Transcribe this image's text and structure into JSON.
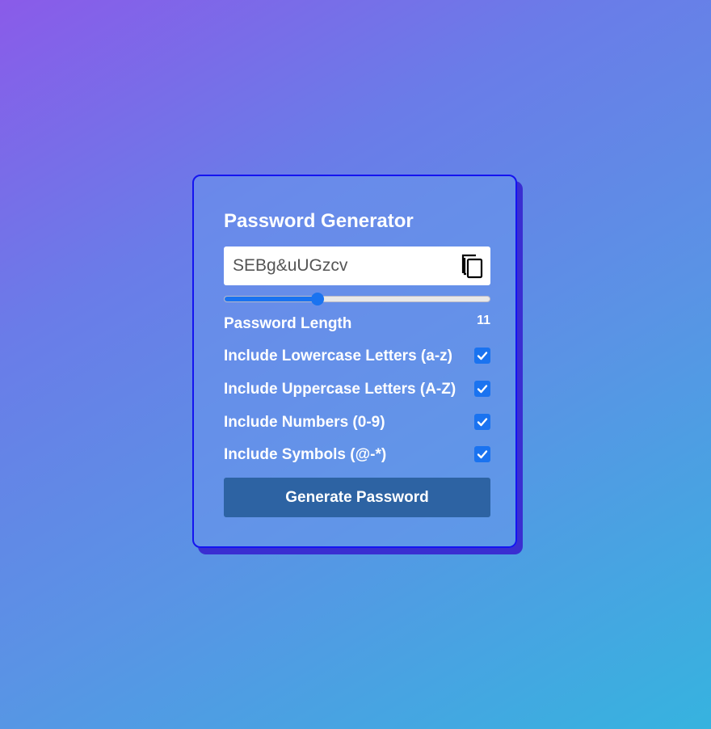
{
  "app": {
    "title": "Password Generator"
  },
  "password": {
    "value": "SEBg&uUGzcv",
    "copy_icon": "copy-icon"
  },
  "length": {
    "label": "Password Length",
    "value": "11",
    "fraction": 0.35
  },
  "options": [
    {
      "label": "Include Lowercase Letters (a-z)",
      "checked": true
    },
    {
      "label": "Include Uppercase Letters (A-Z)",
      "checked": true
    },
    {
      "label": "Include Numbers (0-9)",
      "checked": true
    },
    {
      "label": "Include Symbols (@-*)",
      "checked": true
    }
  ],
  "generate_button": {
    "label": "Generate Password"
  },
  "colors": {
    "accent": "#1a73f0",
    "card_border": "#1414f0",
    "button": "#2d63a3"
  }
}
